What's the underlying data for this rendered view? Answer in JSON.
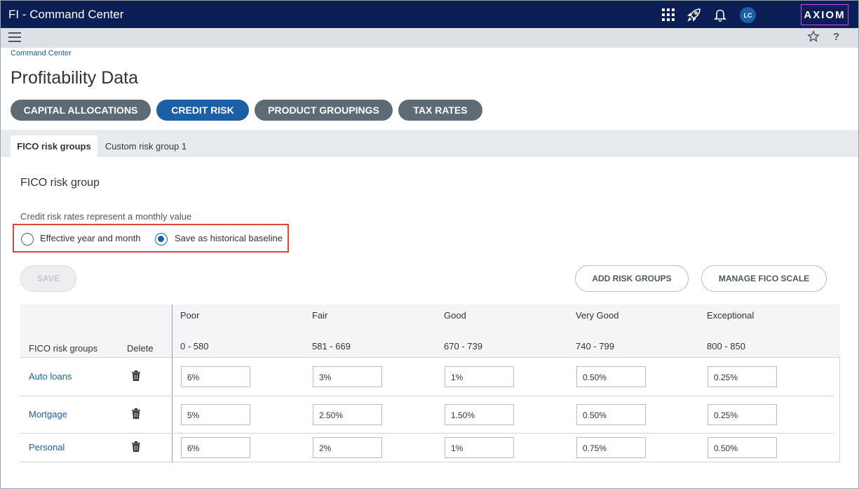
{
  "app": {
    "title": "FI - Command Center",
    "user_initials": "LC",
    "logo_text": "AXIOM",
    "icons": [
      "apps-grid-icon",
      "rocket-icon",
      "bell-icon"
    ]
  },
  "subbar": {
    "menu_icon": "hamburger-icon",
    "favorite_icon": "star-icon",
    "help_label": "?"
  },
  "breadcrumb": "Command Center",
  "page_title": "Profitability Data",
  "nav_pills": [
    {
      "label": "CAPITAL ALLOCATIONS",
      "active": false
    },
    {
      "label": "CREDIT RISK",
      "active": true
    },
    {
      "label": "PRODUCT GROUPINGS",
      "active": false
    },
    {
      "label": "TAX RATES",
      "active": false
    }
  ],
  "tabs": [
    {
      "label": "FICO risk groups",
      "active": true
    },
    {
      "label": "Custom risk group 1",
      "active": false
    }
  ],
  "section": {
    "title": "FICO risk group",
    "note": "Credit risk rates represent a monthly value",
    "radio_options": [
      {
        "label": "Effective year and month",
        "checked": false
      },
      {
        "label": "Save as historical baseline",
        "checked": true
      }
    ]
  },
  "buttons": {
    "save": "SAVE",
    "add_risk_groups": "ADD RISK GROUPS",
    "manage_fico_scale": "MANAGE FICO SCALE"
  },
  "table": {
    "col_group": "FICO risk groups",
    "col_delete": "Delete",
    "bands": [
      {
        "name": "Poor",
        "range": "0 - 580"
      },
      {
        "name": "Fair",
        "range": "581 - 669"
      },
      {
        "name": "Good",
        "range": "670 - 739"
      },
      {
        "name": "Very Good",
        "range": "740 - 799"
      },
      {
        "name": "Exceptional",
        "range": "800 - 850"
      }
    ],
    "rows": [
      {
        "group": "Auto loans",
        "values": [
          "6%",
          "3%",
          "1%",
          "0.50%",
          "0.25%"
        ]
      },
      {
        "group": "Mortgage",
        "values": [
          "5%",
          "2.50%",
          "1.50%",
          "0.50%",
          "0.25%"
        ]
      },
      {
        "group": "Personal",
        "values": [
          "6%",
          "2%",
          "1%",
          "0.75%",
          "0.50%"
        ]
      }
    ]
  },
  "colors": {
    "topbar": "#0b1e55",
    "accent": "#1b5fa6",
    "pill": "#5c6b76",
    "highlight": "#e0443b",
    "logo_border": "#d946ef"
  }
}
